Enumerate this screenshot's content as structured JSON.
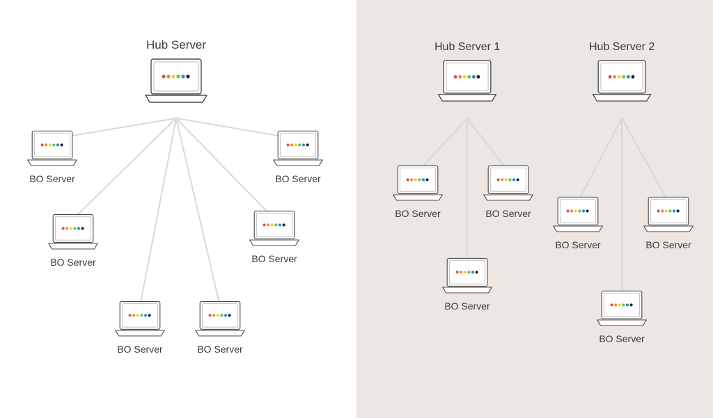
{
  "left": {
    "hub": {
      "label": "Hub Server"
    },
    "bo_tl": {
      "label": "BO Server"
    },
    "bo_tr": {
      "label": "BO Server"
    },
    "bo_ml": {
      "label": "BO Server"
    },
    "bo_mr": {
      "label": "BO Server"
    },
    "bo_bl": {
      "label": "BO Server"
    },
    "bo_br": {
      "label": "BO Server"
    }
  },
  "right": {
    "hub1": {
      "label": "Hub Server 1"
    },
    "hub2": {
      "label": "Hub Server 2"
    },
    "h1_bo_l": {
      "label": "BO Server"
    },
    "h1_bo_r": {
      "label": "BO Server"
    },
    "h1_bo_b": {
      "label": "BO Server"
    },
    "h2_bo_l": {
      "label": "BO Server"
    },
    "h2_bo_r": {
      "label": "BO Server"
    },
    "h2_bo_b": {
      "label": "BO Server"
    }
  },
  "dot_colors": [
    "#E34B4B",
    "#E58F2F",
    "#E8D23A",
    "#66C15A",
    "#2E86D6",
    "#222222"
  ]
}
